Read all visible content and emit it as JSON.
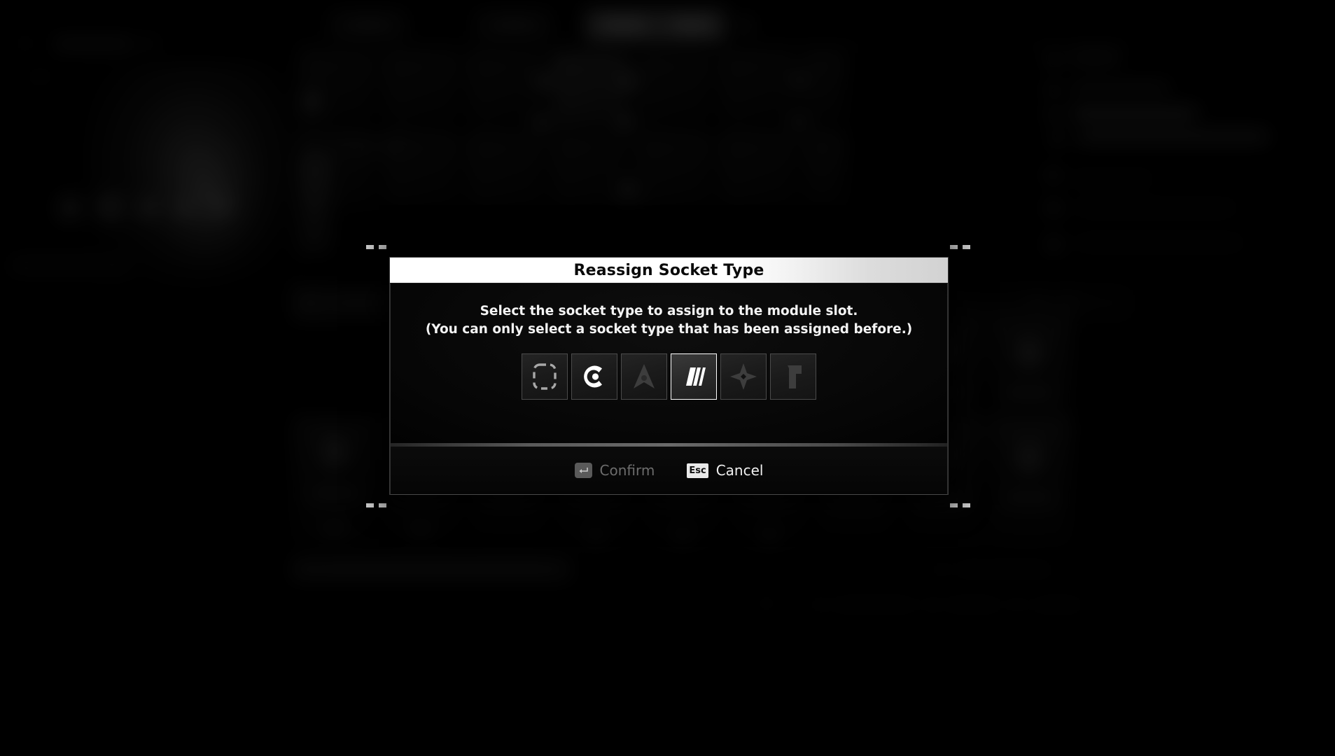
{
  "dialog": {
    "title": "Reassign Socket Type",
    "prompt_line_1": "Select the socket type to assign to the module slot.",
    "prompt_line_2": "(You can only select a socket type that has been assigned before.)",
    "sockets": [
      {
        "name": "empty-socket",
        "icon": "dashed-rounded-square-icon",
        "state": "available",
        "selected": false
      },
      {
        "name": "omega-socket",
        "icon": "c-ring-dot-icon",
        "state": "available",
        "selected": false
      },
      {
        "name": "arrowhead-socket",
        "icon": "chevron-arrowhead-icon",
        "state": "locked",
        "selected": false
      },
      {
        "name": "slash-bars-socket",
        "icon": "triple-slash-bars-icon",
        "state": "available",
        "selected": true
      },
      {
        "name": "shuriken-socket",
        "icon": "four-point-star-icon",
        "state": "locked",
        "selected": false
      },
      {
        "name": "gamma-socket",
        "icon": "gamma-bracket-icon",
        "state": "locked",
        "selected": false
      }
    ],
    "footer": {
      "confirm_key": "Enter",
      "confirm_label": "Confirm",
      "confirm_disabled": true,
      "cancel_key": "Esc",
      "cancel_label": "Cancel"
    },
    "colors": {
      "titlebar_bg": "#ffffff",
      "title_text": "#0a0a0a",
      "body_bg": "#060606",
      "prompt_text": "#f4f4f4",
      "socket_border": "#4b4b4b",
      "socket_selected_border": "#ffffff",
      "icon_active": "#ffffff",
      "icon_locked": "#3a3a3a",
      "confirm_disabled_text": "#6d6d6d",
      "esc_badge_bg": "#e9e9e9",
      "corner_marker": "#d8d8d8"
    }
  }
}
